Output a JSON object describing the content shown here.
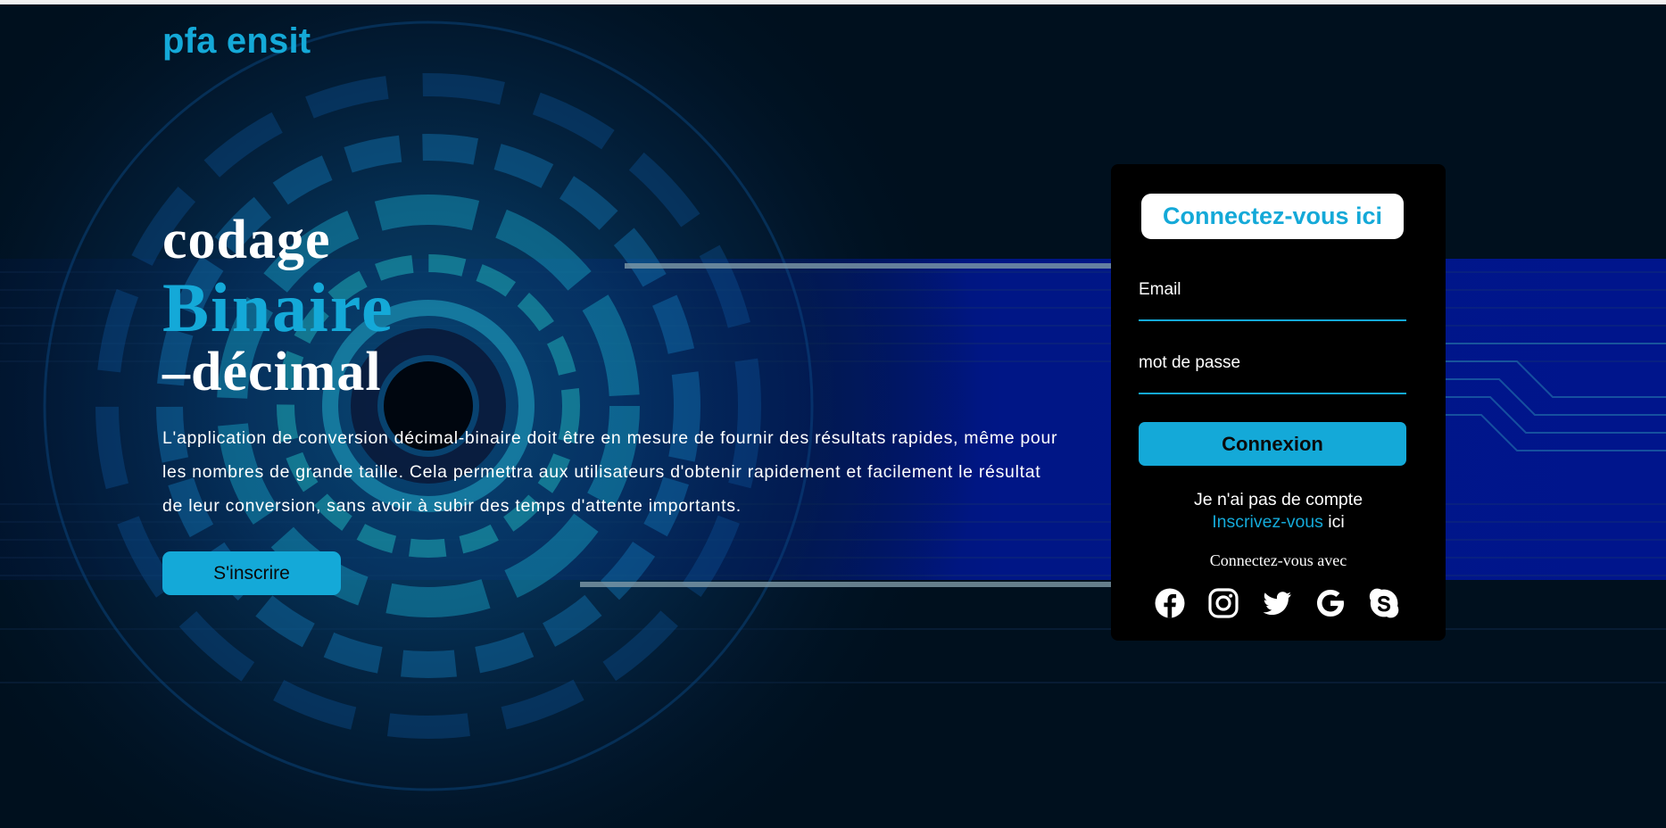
{
  "brand": {
    "logo": "pfa ensit"
  },
  "hero": {
    "title_line1": "codage",
    "title_line2": "Binaire",
    "title_line3": "–décimal",
    "description": "L'application de conversion décimal-binaire doit être en mesure de fournir des résultats rapides, même pour les nombres de grande taille. Cela permettra aux utilisateurs d'obtenir rapidement et facilement le résultat de leur conversion, sans avoir à subir des temps d'attente importants.",
    "signup_button": "S'inscrire"
  },
  "login": {
    "title": "Connectez-vous ici",
    "email_label": "Email",
    "email_value": "",
    "password_label": "mot de passe",
    "password_value": "",
    "submit_button": "Connexion",
    "no_account_text": "Je n'ai pas de compte",
    "signup_link": "Inscrivez-vous",
    "signup_suffix": " ici",
    "social_label": "Connectez-vous avec",
    "social_icons": [
      "facebook-icon",
      "instagram-icon",
      "twitter-icon",
      "google-icon",
      "skype-icon"
    ]
  },
  "colors": {
    "accent": "#14a9d8",
    "background": "#00101e",
    "card": "#000000",
    "text": "#ffffff"
  }
}
